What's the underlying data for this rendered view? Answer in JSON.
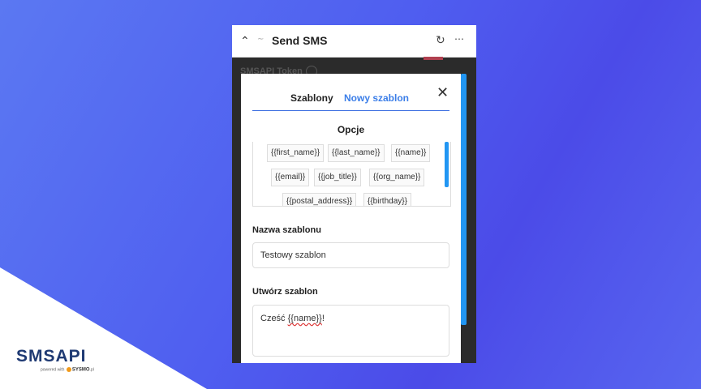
{
  "colors": {
    "accent": "#3b7ee8",
    "scrollbar": "#2196f3",
    "logo": "#1f3a73"
  },
  "brand": {
    "logo_text": "SMSAPI",
    "powered_by": "powered with",
    "partner": "SYSMO",
    "partner_suffix": ".pl"
  },
  "app": {
    "title": "Send SMS",
    "background_label": "SMSAPI Token"
  },
  "modal": {
    "tabs": [
      {
        "label": "Szablony"
      },
      {
        "label": "Nowy szablon"
      }
    ],
    "options_title": "Opcje",
    "options": [
      "{{first_name}}",
      "{{last_name}}",
      "{{name}}",
      "{{email}}",
      "{{job_title}}",
      "{{org_name}}",
      "{{postal_address}}",
      "{{birthday}}"
    ],
    "name_label": "Nazwa szablonu",
    "name_value": "Testowy szablon",
    "body_label": "Utwórz szablon",
    "body_text_prefix": "Cześć ",
    "body_text_token": "{{name}}",
    "body_text_suffix": "!"
  }
}
